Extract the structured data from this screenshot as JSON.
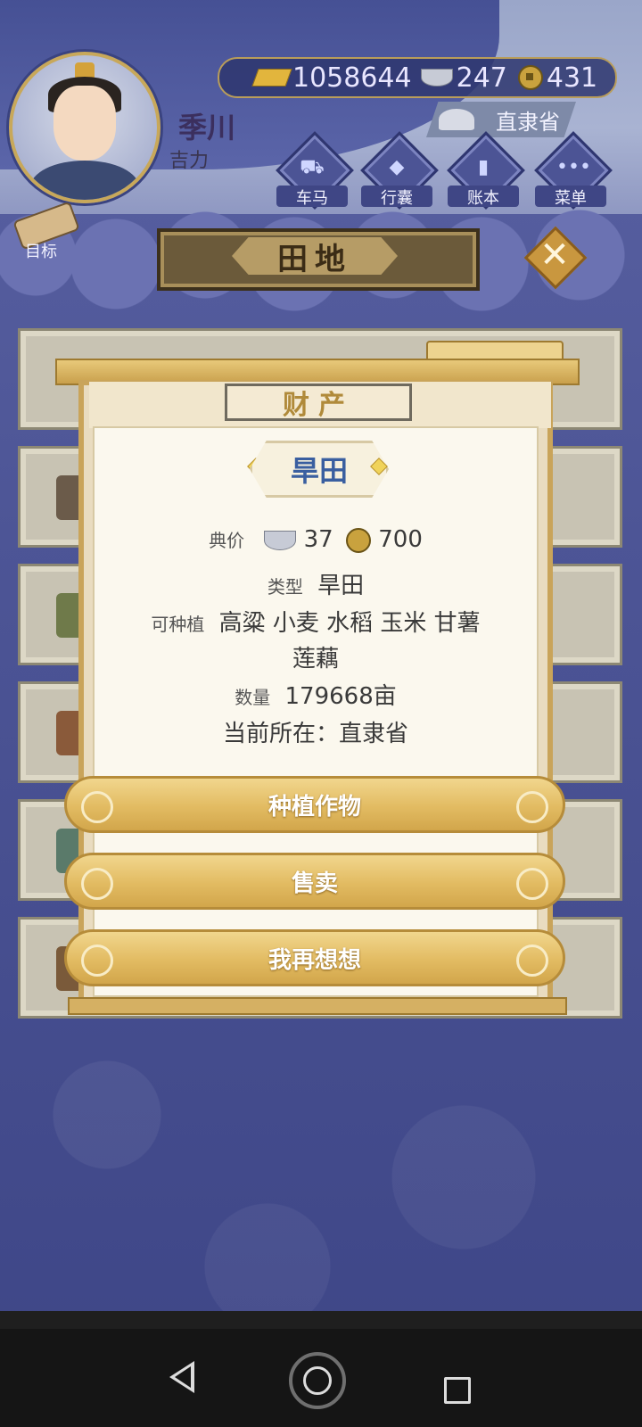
{
  "player": {
    "name": "季川",
    "trait": "吉力"
  },
  "currency": {
    "gold": "1058644",
    "silver": "247",
    "coins": "431"
  },
  "location": "直隶省",
  "nav": [
    {
      "label": "车马",
      "icon": "carriage-icon"
    },
    {
      "label": "行囊",
      "icon": "bag-icon"
    },
    {
      "label": "账本",
      "icon": "ledger-icon"
    },
    {
      "label": "菜单",
      "icon": "menu-dots-icon"
    }
  ],
  "target_label": "目标",
  "page_title": "田地",
  "dialog": {
    "header": "财产",
    "item_name": "旱田",
    "price_label": "典价",
    "price_silver": "37",
    "price_coins": "700",
    "type_label": "类型",
    "type_value": "旱田",
    "plantable_label": "可种植",
    "plantable_value": "高粱 小麦 水稻 玉米 甘薯",
    "plantable_value_2": "莲藕",
    "quantity_label": "数量",
    "quantity_value": "179668亩",
    "location_line": "当前所在：直隶省",
    "buttons": {
      "plant": "种植作物",
      "sell": "售卖",
      "cancel": "我再想想"
    }
  },
  "colors": {
    "accent_gold": "#e2bb62",
    "title_blue": "#3a5fa0",
    "bg_indigo": "#4a5291"
  }
}
